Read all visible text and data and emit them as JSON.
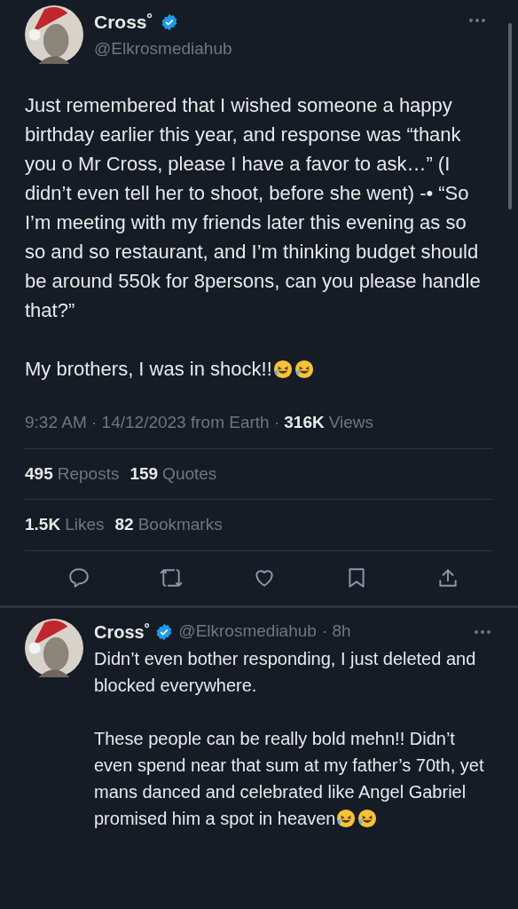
{
  "tweet": {
    "author": {
      "name": "Cross˚",
      "handle": "@Elkrosmediahub",
      "verified": true
    },
    "paragraphs": [
      "Just remembered that I wished someone a happy birthday earlier this year, and response was “thank you o Mr Cross, please I have a favor to ask…” (I didn’t even tell her to shoot, before she went) -• “So I’m meeting with my friends later this evening as so so and so restaurant, and I’m thinking budget should be around 550k for 8persons, can you please handle that?”",
      "My brothers, I was in shock!!"
    ],
    "meta": {
      "time_date": "9:32 AM · 14/12/2023 from Earth ·",
      "views_count": "316K",
      "views_label": "Views"
    },
    "stats_rows": [
      [
        {
          "count": "495",
          "label": "Reposts"
        },
        {
          "count": "159",
          "label": "Quotes"
        }
      ],
      [
        {
          "count": "1.5K",
          "label": "Likes"
        },
        {
          "count": "82",
          "label": "Bookmarks"
        }
      ]
    ]
  },
  "reply": {
    "author": {
      "name": "Cross˚",
      "handle": "@Elkrosmediahub",
      "verified": true
    },
    "time": "· 8h",
    "paragraphs": [
      "Didn’t even bother responding, I just deleted and blocked everywhere.",
      "These people can be really bold mehn!! Didn’t even spend near that sum at my father’s 70th, yet mans danced and celebrated like Angel Gabriel promised him a spot in heaven"
    ]
  }
}
